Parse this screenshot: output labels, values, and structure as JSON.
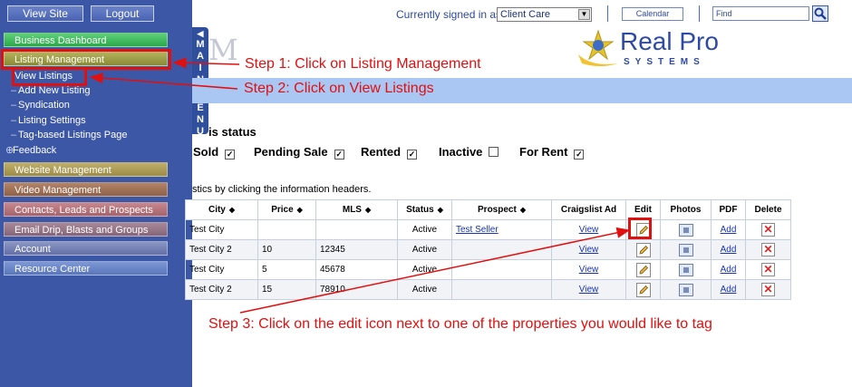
{
  "top_buttons": {
    "view_site": "View Site",
    "logout": "Logout"
  },
  "menu": {
    "vertical_tab": [
      "M",
      "A",
      "I",
      "N",
      "",
      "M",
      "E",
      "N",
      "U"
    ],
    "items": [
      {
        "label": "Business Dashboard"
      },
      {
        "label": "Listing Management"
      },
      {
        "label": "Website Management"
      },
      {
        "label": "Video Management"
      },
      {
        "label": "Contacts, Leads and Prospects"
      },
      {
        "label": "Email Drip, Blasts and Groups"
      },
      {
        "label": "Account"
      },
      {
        "label": "Resource Center"
      }
    ],
    "sub_items": [
      {
        "label": "View Listings"
      },
      {
        "label": "Add New Listing"
      },
      {
        "label": "Syndication"
      },
      {
        "label": "Listing Settings"
      },
      {
        "label": "Tag-based Listings Page"
      },
      {
        "label": "Feedback"
      }
    ],
    "colors": {
      "sidebar": "#3c57a6",
      "highlight": "#e01010"
    }
  },
  "header": {
    "signed_in_label": "Currently signed in as:",
    "user": "Client Care",
    "calendar": "Calendar",
    "find_placeholder": "Find",
    "logo_text": "Real Pro",
    "logo_sub": "SYSTEMS",
    "logo_fragment": "M"
  },
  "status_filter": {
    "title": "is status",
    "options": [
      {
        "label": "Sold",
        "checked": true
      },
      {
        "label": "Pending Sale",
        "checked": true
      },
      {
        "label": "Rented",
        "checked": true
      },
      {
        "label": "Inactive",
        "checked": false
      },
      {
        "label": "For Rent",
        "checked": true
      }
    ]
  },
  "info_text": "stics by clicking the information headers.",
  "table": {
    "headers": [
      "City",
      "Price",
      "MLS",
      "Status",
      "Prospect",
      "Craigslist Ad",
      "Edit",
      "Photos",
      "PDF",
      "Delete"
    ],
    "rows": [
      {
        "city": "Test City",
        "price": "",
        "mls": "",
        "status": "Active",
        "prospect": "Test Seller",
        "craigslist": "View",
        "pdf": "Add"
      },
      {
        "city": "Test City 2",
        "price": "10",
        "mls": "12345",
        "status": "Active",
        "prospect": "",
        "craigslist": "View",
        "pdf": "Add"
      },
      {
        "city": "Test City",
        "price": "5",
        "mls": "45678",
        "status": "Active",
        "prospect": "",
        "craigslist": "View",
        "pdf": "Add"
      },
      {
        "city": "Test City 2",
        "price": "15",
        "mls": "78910",
        "status": "Active",
        "prospect": "",
        "craigslist": "View",
        "pdf": "Add"
      }
    ]
  },
  "annotations": {
    "step1": "Step 1: Click on Listing Management",
    "step2": "Step 2: Click on View Listings",
    "step3": "Step 3: Click on the edit icon next to one of the properties you would like to tag"
  }
}
